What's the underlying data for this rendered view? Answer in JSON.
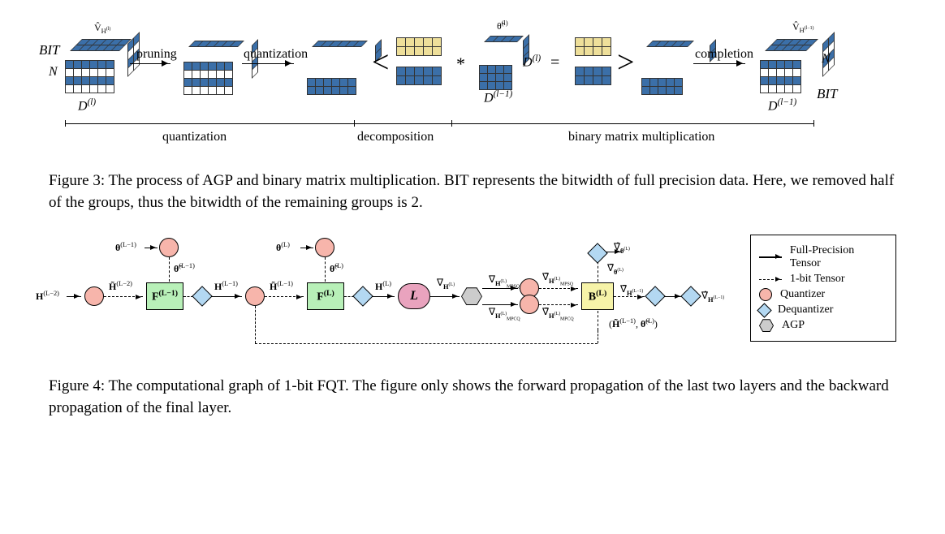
{
  "fig3": {
    "bit_label_left": "BIT",
    "N_label": "N",
    "D_label_input": "D",
    "D_sup_input": "(l)",
    "vhat_label": "V̂",
    "vhat_sub": "H",
    "vhat_sup": "(l)",
    "pruning": "pruning",
    "quantization": "quantization",
    "completion": "completion",
    "theta_tilde": "θ̃",
    "theta_sup": "(l)",
    "D_label_mid": "D",
    "D_sup_mid": "(l)",
    "D_label_prev": "D",
    "D_sup_prev": "(l−1)",
    "star": "*",
    "eq": "=",
    "vhat_label_right": "V̂",
    "vhat_sub_right": "H",
    "vhat_sup_right": "(l−1)",
    "bit_label_right": "BIT",
    "N_label_right": "N",
    "D_label_right": "D",
    "D_sup_right": "(l−1)",
    "bracket_quant": "quantization",
    "bracket_decomp": "decomposition",
    "bracket_bmm": "binary matrix multiplication"
  },
  "caption3": "Figure 3: The process of AGP and binary matrix multiplication. BIT represents the bitwidth of full precision data. Here, we removed half of the groups, thus the bitwidth of the remaining groups is 2.",
  "BIT_italic": "BIT",
  "fig4": {
    "H_Lm2": "H",
    "H_Lm2_sup": "(L−2)",
    "H_Lm2_tilde": "H̃",
    "H_Lm2_tilde_sup": "(L−2)",
    "theta_Lm1": "θ",
    "theta_Lm1_sup": "(L−1)",
    "theta_Lm1_tilde": "θ̃",
    "theta_Lm1_tilde_sup": "(L−1)",
    "F_Lm1": "F",
    "F_Lm1_sup": "(L−1)",
    "H_Lm1": "H",
    "H_Lm1_sup": "(L−1)",
    "H_Lm1_tilde": "H̃",
    "H_Lm1_tilde_sup": "(L−1)",
    "theta_L": "θ",
    "theta_L_sup": "(L)",
    "theta_L_tilde": "θ̃",
    "theta_L_tilde_sup": "(L)",
    "F_L": "F",
    "F_L_sup": "(L)",
    "H_L": "H",
    "H_L_sup": "(L)",
    "loss": "L",
    "grad_HL": "∇",
    "grad_HL_sub": "H",
    "grad_HL_sup": "(L)",
    "MPSQ": "MPSQ",
    "MPCQ": "MPCQ",
    "grad_theta_hat": "∇̂",
    "grad_theta_sub": "θ",
    "grad_theta_sup": "(L)",
    "grad_theta_bar": "∇̄",
    "grad_H_bar": "∇̄",
    "grad_H_bar_sub": "H",
    "grad_H_bar_sup": "(L−1)",
    "grad_H_hat": "∇̂",
    "grad_H_hat_sub": "H",
    "grad_H_hat_sup": "(L−1)",
    "B_L": "B",
    "B_L_sup": "(L)",
    "pair": "(H̃",
    "pair_sup1": "(L−1)",
    "pair_mid": ", θ̃",
    "pair_sup2": "(L)",
    "pair_end": ")"
  },
  "legend": {
    "full": "Full-Precision Tensor",
    "onebit": "1-bit Tensor",
    "quant": "Quantizer",
    "dequant": "Dequantizer",
    "agp": "AGP"
  },
  "caption4": "Figure 4: The computational graph of 1-bit FQT. The figure only shows the forward propagation of the last two layers and the backward propagation of the final layer."
}
